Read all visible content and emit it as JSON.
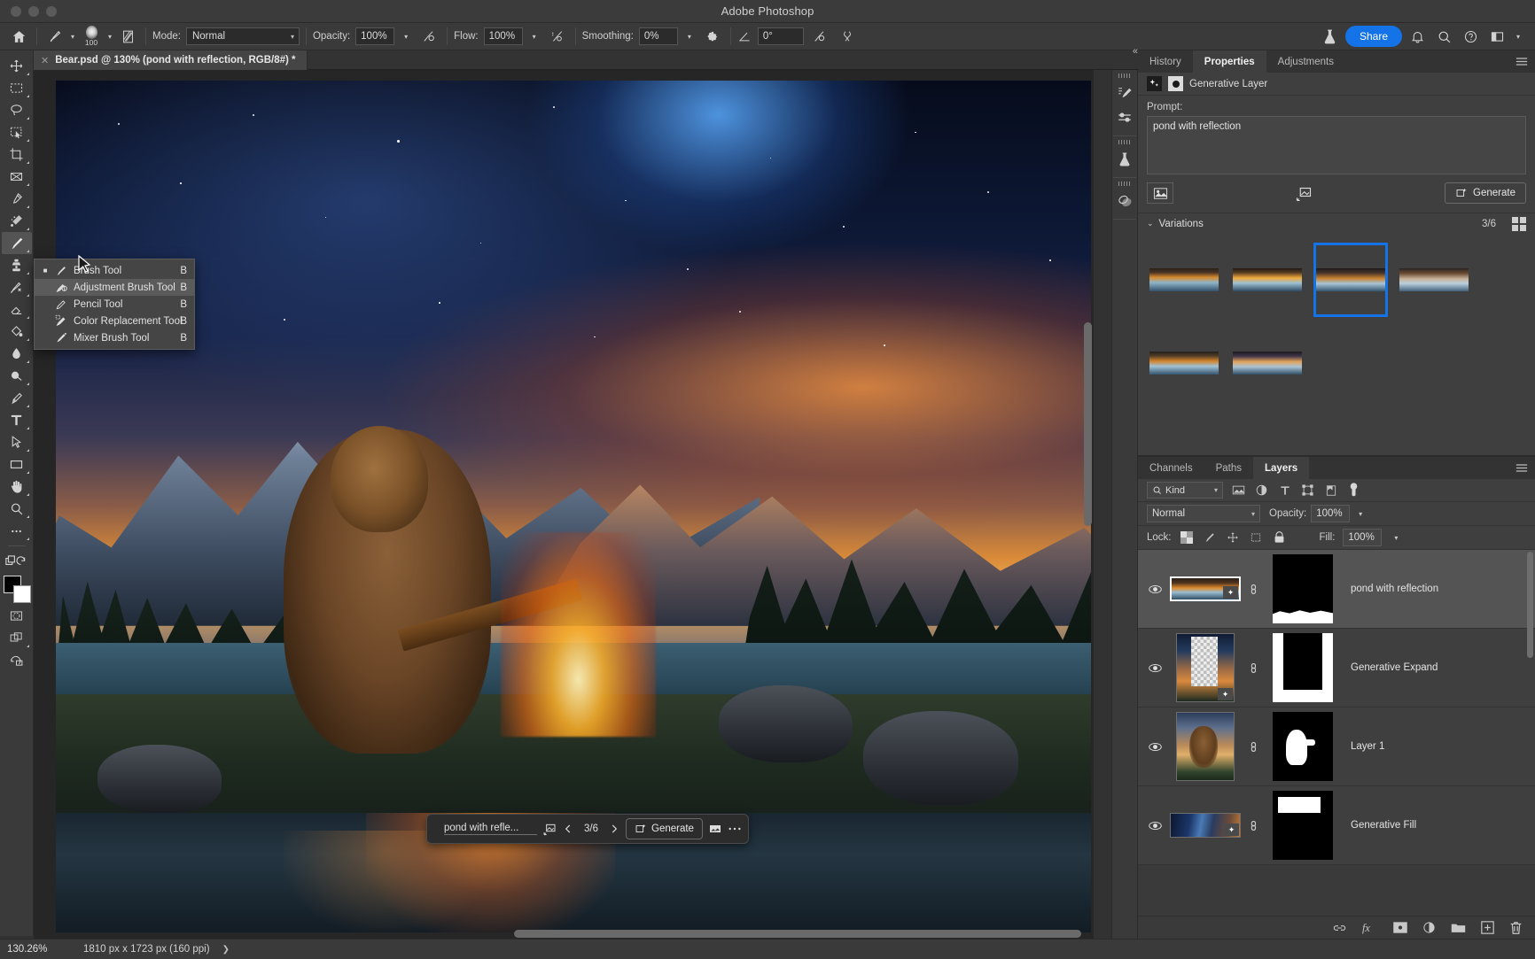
{
  "app": {
    "title": "Adobe Photoshop"
  },
  "options_bar": {
    "home_icon": "home-icon",
    "brush_preset_icon": "brush-preset-icon",
    "brush_size": "100",
    "brush_settings_icon": "brush-settings-icon",
    "mode_label": "Mode:",
    "mode_value": "Normal",
    "opacity_label": "Opacity:",
    "opacity_value": "100%",
    "opacity_pressure_icon": "pressure-opacity-icon",
    "flow_label": "Flow:",
    "flow_value": "100%",
    "airbrush_icon": "airbrush-icon",
    "smoothing_label": "Smoothing:",
    "smoothing_value": "0%",
    "smoothing_gear_icon": "gear-icon",
    "angle_icon": "angle-icon",
    "angle_value": "0°",
    "tablet_pressure_icon": "tablet-pressure-size-icon",
    "symmetry_icon": "symmetry-icon",
    "lab_icon": "beaker-icon",
    "share_label": "Share",
    "notification_icon": "bell-icon",
    "search_icon": "search-icon",
    "help_icon": "help-icon",
    "workspace_icon": "workspace-icon",
    "workspace_caret_icon": "chevron-down-icon"
  },
  "document_tab": {
    "close_icon": "close-icon",
    "title": "Bear.psd @ 130% (pond with reflection, RGB/8#) *"
  },
  "toolbar": {
    "tools": [
      {
        "name": "move-tool",
        "icon": "move",
        "selected": false
      },
      {
        "name": "marquee-tool",
        "icon": "marquee",
        "selected": false
      },
      {
        "name": "lasso-tool",
        "icon": "lasso",
        "selected": false
      },
      {
        "name": "object-selection-tool",
        "icon": "objsel",
        "selected": false
      },
      {
        "name": "crop-tool",
        "icon": "crop",
        "selected": false
      },
      {
        "name": "frame-tool",
        "icon": "frame",
        "selected": false
      },
      {
        "name": "eyedropper-tool",
        "icon": "eyedropper",
        "selected": false
      },
      {
        "name": "spot-healing-brush-tool",
        "icon": "heal",
        "selected": false
      },
      {
        "name": "brush-tool",
        "icon": "brush",
        "selected": true
      },
      {
        "name": "clone-stamp-tool",
        "icon": "stamp",
        "selected": false
      },
      {
        "name": "history-brush-tool",
        "icon": "histbrush",
        "selected": false
      },
      {
        "name": "eraser-tool",
        "icon": "eraser",
        "selected": false
      },
      {
        "name": "gradient-tool",
        "icon": "bucket",
        "selected": false
      },
      {
        "name": "blur-tool",
        "icon": "blur",
        "selected": false
      },
      {
        "name": "dodge-tool",
        "icon": "dodge",
        "selected": false
      },
      {
        "name": "pen-tool",
        "icon": "pen",
        "selected": false
      },
      {
        "name": "type-tool",
        "icon": "type",
        "selected": false
      },
      {
        "name": "path-selection-tool",
        "icon": "pathsel",
        "selected": false
      },
      {
        "name": "rectangle-tool",
        "icon": "rect",
        "selected": false
      },
      {
        "name": "hand-tool",
        "icon": "hand",
        "selected": false
      },
      {
        "name": "zoom-tool",
        "icon": "zoom",
        "selected": false
      },
      {
        "name": "edit-toolbar-button",
        "icon": "dots",
        "selected": false
      }
    ],
    "foreground_color": "#000000",
    "background_color": "#ffffff",
    "quick-mask-icon": "quick-mask-icon",
    "screen-mode-icon": "screen-mode-icon",
    "generative-icon": "generative-icon"
  },
  "flyout_menu": {
    "items": [
      {
        "label": "Brush Tool",
        "shortcut": "B",
        "icon": "brush-icon",
        "active": true,
        "hover": false
      },
      {
        "label": "Adjustment Brush Tool",
        "shortcut": "B",
        "icon": "adjustment-brush-icon",
        "active": false,
        "hover": true
      },
      {
        "label": "Pencil Tool",
        "shortcut": "B",
        "icon": "pencil-icon",
        "active": false,
        "hover": false
      },
      {
        "label": "Color Replacement Tool",
        "shortcut": "B",
        "icon": "color-replacement-icon",
        "active": false,
        "hover": false
      },
      {
        "label": "Mixer Brush Tool",
        "shortcut": "B",
        "icon": "mixer-brush-icon",
        "active": false,
        "hover": false
      }
    ]
  },
  "contextual_taskbar": {
    "prompt": "pond with refle...",
    "image_ref_icon": "image-reference-icon",
    "prev_icon": "chevron-left-icon",
    "counter": "3/6",
    "next_icon": "chevron-right-icon",
    "generate_label": "Generate",
    "generate_icon": "generate-icon",
    "gallery_icon": "gallery-icon",
    "more_icon": "more-options-icon"
  },
  "right_dock": {
    "rail_icons": [
      "brush-settings-panel-icon",
      "brush-presets-panel-icon",
      "lab-panel-icon",
      "clone-source-panel-icon"
    ],
    "collapse_icon": "collapse-panels-icon"
  },
  "properties_panel": {
    "tabs": [
      {
        "label": "History",
        "active": false
      },
      {
        "label": "Properties",
        "active": true
      },
      {
        "label": "Adjustments",
        "active": false
      }
    ],
    "menu_icon": "panel-menu-icon",
    "layer_type": "Generative Layer",
    "layer_type_icon": "generative-layer-icon",
    "mask_icon": "layer-mask-icon",
    "prompt_label": "Prompt:",
    "prompt_value": "pond with reflection",
    "reference_image_icon": "reference-image-icon",
    "gen_image_icon": "generate-image-icon",
    "generate_label": "Generate",
    "generate_icon": "generate-icon",
    "variations": {
      "title": "Variations",
      "expand_icon": "chevron-down-icon",
      "counter": "3/6",
      "grid_view_icon": "grid-view-icon",
      "items": [
        {
          "name": "variation-1",
          "selected": false
        },
        {
          "name": "variation-2",
          "selected": false
        },
        {
          "name": "variation-3",
          "selected": true
        },
        {
          "name": "variation-4",
          "selected": false
        },
        {
          "name": "variation-5",
          "selected": false
        },
        {
          "name": "variation-6",
          "selected": false
        }
      ]
    }
  },
  "layers_panel": {
    "tabs": [
      {
        "label": "Channels",
        "active": false
      },
      {
        "label": "Paths",
        "active": false
      },
      {
        "label": "Layers",
        "active": true
      }
    ],
    "menu_icon": "panel-menu-icon",
    "filter": {
      "kind_label": "Kind",
      "search_icon": "search-icon",
      "caret_icon": "chevron-down-icon",
      "filter_icons": [
        "pixel-filter-icon",
        "adjustment-filter-icon",
        "type-filter-icon",
        "shape-filter-icon",
        "smart-object-filter-icon"
      ],
      "toggle_icon": "filter-toggle-icon"
    },
    "blend_mode": "Normal",
    "blend_caret_icon": "chevron-down-icon",
    "opacity_label": "Opacity:",
    "opacity_value": "100%",
    "lock_label": "Lock:",
    "lock_icons": [
      "lock-transparency-icon",
      "lock-image-icon",
      "lock-position-icon",
      "lock-artboard-icon",
      "lock-all-icon"
    ],
    "fill_label": "Fill:",
    "fill_value": "100%",
    "layers": [
      {
        "name": "pond with reflection",
        "visible": true,
        "selected": true,
        "thumb": "gen-pond",
        "mask": "mask-pond",
        "linked": true,
        "ai_badge": true
      },
      {
        "name": "Generative Expand",
        "visible": true,
        "selected": false,
        "thumb": "gen-expand",
        "mask": "mask-expand",
        "linked": true,
        "ai_badge": true
      },
      {
        "name": "Layer 1",
        "visible": true,
        "selected": false,
        "thumb": "bear-layer",
        "mask": "mask-bear",
        "linked": true,
        "ai_badge": false
      },
      {
        "name": "Generative Fill",
        "visible": true,
        "selected": false,
        "thumb": "gen-fill",
        "mask": "mask-fill",
        "linked": true,
        "ai_badge": true
      }
    ],
    "footer_icons": [
      "link-layers-icon",
      "layer-style-fx-icon",
      "add-layer-mask-icon",
      "adjustment-layer-icon",
      "new-group-icon",
      "new-layer-icon",
      "delete-layer-icon"
    ]
  },
  "status_bar": {
    "zoom": "130.26%",
    "dimensions": "1810 px x 1723 px (160 ppi)",
    "expand_icon": "chevron-right-icon"
  },
  "colors": {
    "accent_blue": "#1473e6",
    "panel_bg": "#3a3a3a",
    "panel_bg_light": "#3f3f3f",
    "selection": "#545454",
    "canvas_bg": "#262626"
  }
}
